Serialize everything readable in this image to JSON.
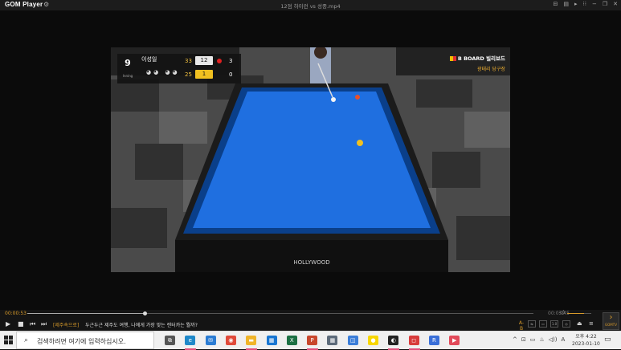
{
  "window": {
    "app_name": "GOM Player",
    "title": "12점 하이런 vs 성중.mp4",
    "controls": [
      "⊟",
      "▤",
      "▸",
      "⁝⁝",
      "−",
      "❐",
      "✕"
    ]
  },
  "video": {
    "scoreboard": {
      "inning": "9",
      "inning_label": "Inning",
      "player_name": "이성일",
      "avatar": "◕◕ ◕◕",
      "rows": [
        {
          "target": "33",
          "score": "12",
          "sets": "3"
        },
        {
          "target": "25",
          "score": "1",
          "sets": "0"
        }
      ]
    },
    "brand": {
      "name": "B BOARD 빌리보드",
      "sub": "광태리 당구장"
    },
    "table_logo": "HOLLYWOOD"
  },
  "player": {
    "time_elapsed": "00:00:53",
    "time_total": "00:03:45",
    "progress": 0.231,
    "volume": 0.7,
    "ticker_tag": "[제주속으로]",
    "ticker_text": "두근두근 제주도 여행, 나에게 가장 맞는 렌터카는 뭘까?",
    "right_buttons": [
      "A-B",
      "⇆",
      "1.0",
      "◎"
    ],
    "gomtv_label": "GOMTV"
  },
  "taskbar": {
    "search_placeholder": "검색하려면 여기에 입력하십시오.",
    "apps": [
      {
        "name": "task-view",
        "glyph": "⧉",
        "color": "#555555"
      },
      {
        "name": "edge",
        "glyph": "e",
        "color": "#1e88c9"
      },
      {
        "name": "mail",
        "glyph": "✉",
        "color": "#2b7cd3"
      },
      {
        "name": "chrome",
        "glyph": "◉",
        "color": "#e04a3a"
      },
      {
        "name": "explorer",
        "glyph": "▬",
        "color": "#f0b429"
      },
      {
        "name": "store",
        "glyph": "▦",
        "color": "#1976d2"
      },
      {
        "name": "excel",
        "glyph": "X",
        "color": "#1d7044"
      },
      {
        "name": "powerpoint",
        "glyph": "P",
        "color": "#c8462c"
      },
      {
        "name": "calculator",
        "glyph": "▦",
        "color": "#5d6b7a"
      },
      {
        "name": "photo",
        "glyph": "◫",
        "color": "#3b7dd8"
      },
      {
        "name": "kakaotalk",
        "glyph": "●",
        "color": "#f7d600"
      },
      {
        "name": "github",
        "glyph": "◐",
        "color": "#222222"
      },
      {
        "name": "pinned-app",
        "glyph": "◻",
        "color": "#d83b3b"
      },
      {
        "name": "rewind",
        "glyph": "R",
        "color": "#3a6fd8"
      },
      {
        "name": "gom",
        "glyph": "▶",
        "color": "#e24a5a"
      }
    ],
    "tray": [
      "^",
      "⊡",
      "▭",
      "♨",
      "◁))",
      "A"
    ],
    "time": "오후 4:22",
    "date": "2023-01-10"
  }
}
